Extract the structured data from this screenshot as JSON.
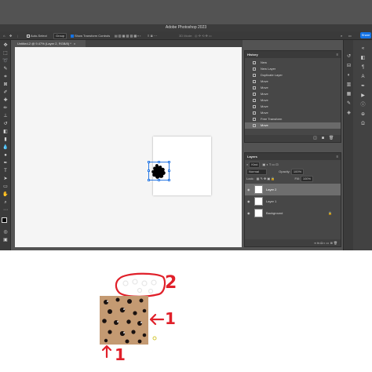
{
  "app": {
    "title": "Adobe Photoshop 2023"
  },
  "options_bar": {
    "auto_select_label": "Auto-Select",
    "auto_select_target": "Group",
    "show_transform_label": "Show Transform Controls",
    "mode_3d_label": "3D Mode:",
    "share_label": "Share"
  },
  "document": {
    "tab_title": "Untitled-2 @ 9.47% (Layer 2, RGB/8) *"
  },
  "history": {
    "title": "History",
    "items": [
      {
        "label": "New",
        "selected": false
      },
      {
        "label": "New Layer",
        "selected": false
      },
      {
        "label": "Duplicate Layer",
        "selected": false
      },
      {
        "label": "Move",
        "selected": false
      },
      {
        "label": "Move",
        "selected": false
      },
      {
        "label": "Move",
        "selected": false
      },
      {
        "label": "Move",
        "selected": false
      },
      {
        "label": "Move",
        "selected": false
      },
      {
        "label": "Move",
        "selected": false
      },
      {
        "label": "Free Transform",
        "selected": false
      },
      {
        "label": "Move",
        "selected": true
      }
    ]
  },
  "layers": {
    "title": "Layers",
    "filter_label": "Kind",
    "blend_mode": "Normal",
    "opacity_label": "Opacity:",
    "opacity_value": "100%",
    "lock_label": "Lock:",
    "fill_label": "Fill:",
    "fill_value": "100%",
    "items": [
      {
        "name": "Layer 2",
        "selected": true
      },
      {
        "name": "Layer 1",
        "selected": false
      },
      {
        "name": "Background",
        "selected": false
      }
    ]
  },
  "annotations": {
    "label_1a": "1",
    "label_1b": "1",
    "label_2": "2"
  },
  "colors": {
    "accent": "#1473e6",
    "panel_bg": "#474747",
    "canvas_bg": "#f5f5f5",
    "sketch_red": "#e0202a",
    "cookie_brown": "#c49a72"
  }
}
